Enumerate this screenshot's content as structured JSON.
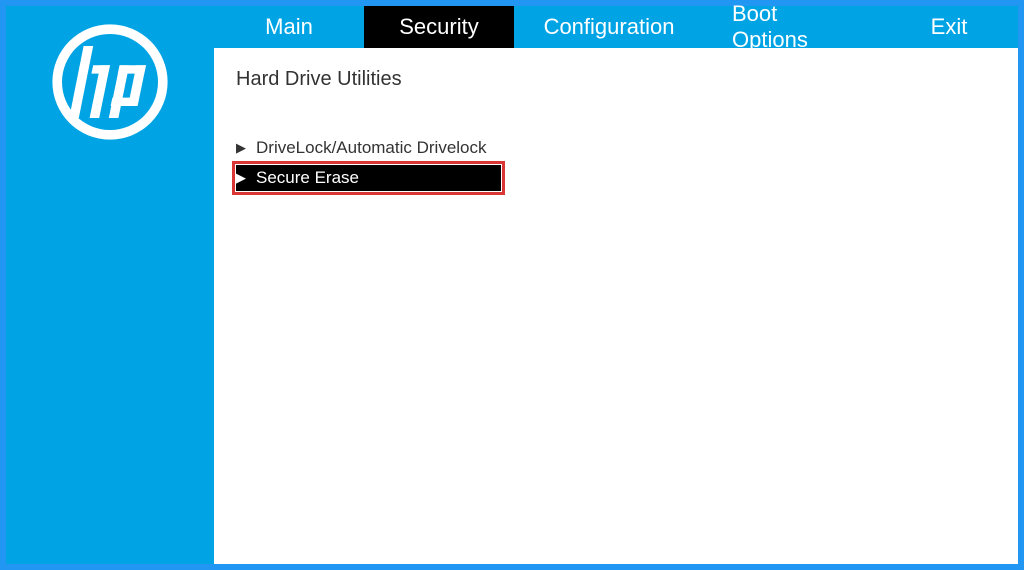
{
  "brand": "hp",
  "tabs": {
    "main": "Main",
    "security": "Security",
    "configuration": "Configuration",
    "boot_options": "Boot Options",
    "exit": "Exit"
  },
  "active_tab": "security",
  "page": {
    "title": "Hard Drive Utilities",
    "items": [
      {
        "label": "DriveLock/Automatic Drivelock",
        "selected": false,
        "highlighted": false
      },
      {
        "label": "Secure Erase",
        "selected": true,
        "highlighted": true
      }
    ]
  }
}
